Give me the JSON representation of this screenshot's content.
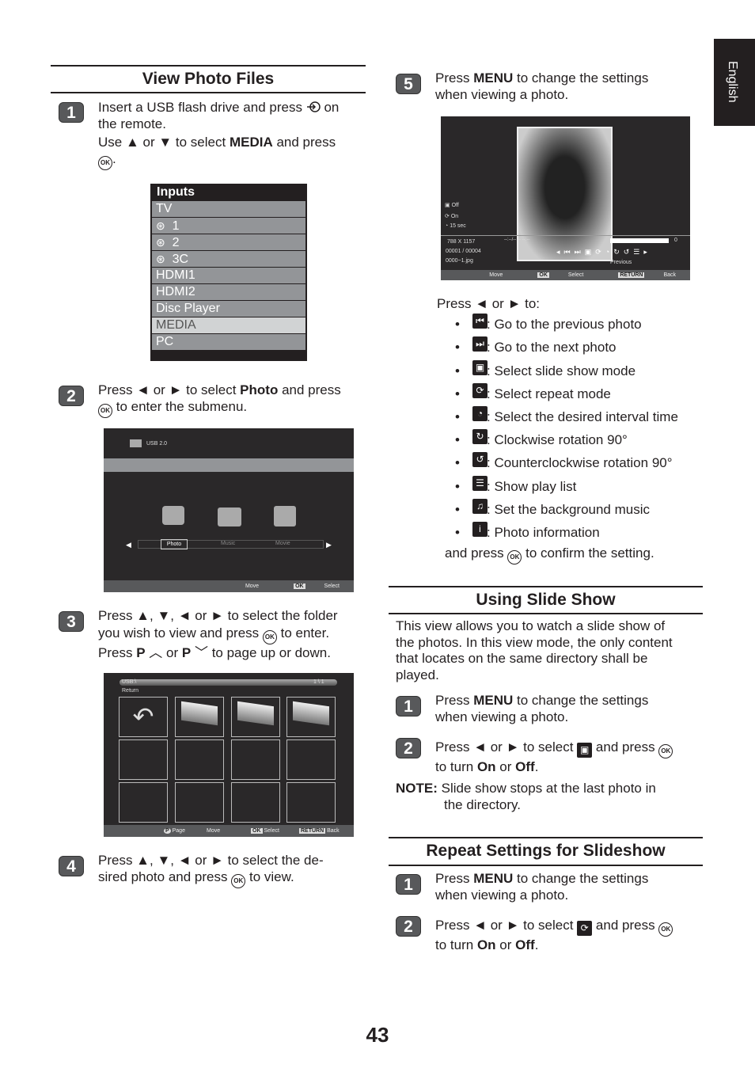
{
  "side_tab": "English",
  "page_number": "43",
  "left": {
    "title": "View Photo Files",
    "step1": {
      "num": "1",
      "l1a": "Insert a USB flash drive and press",
      "l1b": "on",
      "l2": "the remote.",
      "l3a": "Use ▲ or ▼ to select",
      "l3b": "MEDIA",
      "l3c": "and press",
      "l4": "."
    },
    "inputs_menu": {
      "title": "Inputs",
      "items": [
        "TV",
        "1",
        "2",
        "3C",
        "HDMI1",
        "HDMI2",
        "Disc Player",
        "MEDIA",
        "PC"
      ],
      "selected": "MEDIA"
    },
    "step2": {
      "num": "2",
      "l1a": "Press ◄ or ► to select",
      "l1b": "Photo",
      "l1c": "and press",
      "l2": "to enter the submenu."
    },
    "media_screen": {
      "device": "USB 2.0",
      "tabs": [
        "Photo",
        "Music",
        "Movie"
      ],
      "selected": "Photo",
      "hint_move": "Move",
      "hint_ok": "OK",
      "hint_select": "Select"
    },
    "step3": {
      "num": "3",
      "l1": "Press ▲, ▼, ◄ or ► to select the folder",
      "l2a": "you wish to view and press",
      "l2b": "to enter.",
      "l3a": "Press",
      "p": "P",
      "l3b": "or",
      "l3c": "to page up or down."
    },
    "folder_screen": {
      "path": "USB:\\",
      "page": "1 \\ 1",
      "return_label": "Return",
      "hint_p": "P",
      "hint_page": "Page",
      "hint_move": "Move",
      "hint_ok": "OK",
      "hint_select": "Select",
      "hint_return": "RETURN",
      "hint_back": "Back"
    },
    "step4": {
      "num": "4",
      "l1": "Press ▲, ▼, ◄ or ► to select the de-",
      "l2a": "sired photo and press",
      "l2b": "to view."
    }
  },
  "right": {
    "step5": {
      "num": "5",
      "l1a": "Press",
      "l1b": "MENU",
      "l1c": "to change the settings",
      "l2": "when viewing a photo."
    },
    "photo_screen": {
      "slideshow": "Off",
      "repeat": "On",
      "interval": "15 sec",
      "resolution": "788 X 1157",
      "index": "00001 / 00004",
      "filename": "0000~1.jpg",
      "time": "--:--/--:--  --:--",
      "volume": "0",
      "tooltip": "Previous",
      "hint_move": "Move",
      "hint_ok": "OK",
      "hint_select": "Select",
      "hint_return": "RETURN",
      "hint_back": "Back"
    },
    "press_intro": "Press ◄ or ► to:",
    "bullets": [
      {
        "icon": "previous-icon",
        "glyph": "⏮",
        "text": ": Go to the previous photo"
      },
      {
        "icon": "next-icon",
        "glyph": "⏭",
        "text": ": Go to the next photo"
      },
      {
        "icon": "slideshow-icon",
        "glyph": "▣",
        "text": ": Select slide show mode"
      },
      {
        "icon": "repeat-icon",
        "glyph": "⟳",
        "text": ": Select repeat mode"
      },
      {
        "icon": "clock-icon",
        "glyph": "◔",
        "text": ": Select the desired interval time"
      },
      {
        "icon": "rotate-cw-icon",
        "glyph": "↻",
        "text": ": Clockwise rotation 90°"
      },
      {
        "icon": "rotate-ccw-icon",
        "glyph": "↺",
        "text": ": Counterclockwise rotation 90°"
      },
      {
        "icon": "playlist-icon",
        "glyph": "☰",
        "text": ": Show play list"
      },
      {
        "icon": "music-icon",
        "glyph": "♫",
        "text": ": Set the background music"
      },
      {
        "icon": "info-icon",
        "glyph": "i",
        "text": ": Photo information"
      }
    ],
    "confirm_a": "and press",
    "confirm_b": "to confirm the setting.",
    "slide": {
      "title": "Using Slide Show",
      "p1": "This view allows you to watch a slide show of",
      "p2": "the photos. In this view mode, the only content",
      "p3": "that locates on the same directory shall be",
      "p4": "played.",
      "s1": {
        "num": "1",
        "a": "Press",
        "b": "MENU",
        "c": "to change the settings",
        "d": "when viewing a photo."
      },
      "s2": {
        "num": "2",
        "a": "Press ◄ or ► to select",
        "b": "and press",
        "c": "to turn",
        "on": "On",
        "or": "or",
        "off": "Off",
        "end": "."
      },
      "note_label": "NOTE:",
      "note1": "Slide show stops at the last photo in",
      "note2": "the directory."
    },
    "repeat": {
      "title": "Repeat Settings for Slideshow",
      "s1": {
        "num": "1",
        "a": "Press",
        "b": "MENU",
        "c": "to change the settings",
        "d": "when viewing a photo."
      },
      "s2": {
        "num": "2",
        "a": "Press ◄ or ► to select",
        "b": "and press",
        "c": "to turn",
        "on": "On",
        "or": "or",
        "off": "Off",
        "end": "."
      }
    }
  }
}
